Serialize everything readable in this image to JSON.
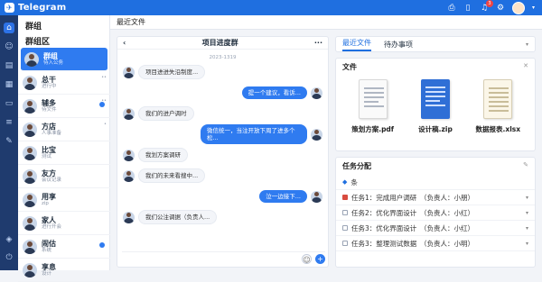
{
  "app": {
    "title": "Telegram",
    "logo_glyph": "✈"
  },
  "topbar": {
    "notification_count": "3"
  },
  "sidebar": {
    "title": "群组",
    "subtitle": "群组区",
    "chats": [
      {
        "name": "群组",
        "sub": "待入公务",
        "active": true
      },
      {
        "name": "总干",
        "sub": "进行中",
        "meta": "••"
      },
      {
        "name": "辅多",
        "sub": "待文件",
        "meta": "••"
      },
      {
        "name": "方店",
        "sub": "人事准备",
        "meta": "•"
      },
      {
        "name": "比宝",
        "sub": "测试"
      },
      {
        "name": "友方",
        "sub": "会议记录"
      },
      {
        "name": "用享",
        "sub": "zip"
      },
      {
        "name": "家人",
        "sub": "进行开会"
      },
      {
        "name": "闹估",
        "sub": "系统"
      },
      {
        "name": "享息",
        "sub": "设计"
      }
    ]
  },
  "main": {
    "header": "最近文件"
  },
  "chat": {
    "title": "项目进度群",
    "date": "2023-1319",
    "messages": [
      {
        "side": "left",
        "text": "项目进进失沿制度..."
      },
      {
        "side": "right",
        "text": "提一个建议，看诉..."
      },
      {
        "side": "left",
        "text": "我们的进户调时"
      },
      {
        "side": "right",
        "text": "微信统一，当注开放下周了进多个松..."
      },
      {
        "side": "left",
        "text": "我划方案调研"
      },
      {
        "side": "left",
        "text": "我们的未来看搜中..."
      },
      {
        "side": "right",
        "text": "泣一边接下..."
      },
      {
        "side": "left",
        "text": "我们公注调据（负责人..."
      }
    ]
  },
  "right": {
    "tabs": [
      "最近文件",
      "待办事项"
    ],
    "files_title": "文件",
    "files": [
      {
        "name": "策划方案.pdf",
        "kind": "pdf"
      },
      {
        "name": "设计稿.zip",
        "kind": "zip"
      },
      {
        "name": "数据报表.xlsx",
        "kind": "xls"
      }
    ],
    "tasks_title": "任务分配",
    "tasks_pre": "条",
    "tasks": [
      "任务1：完成用户调研　（负责人：小朋）",
      "任务2：优化界面设计　（负责人：小红）",
      "任务3：优化界面设计　（负责人：小红）",
      "任务3：整理测试数据　（负责人：小明）"
    ]
  }
}
